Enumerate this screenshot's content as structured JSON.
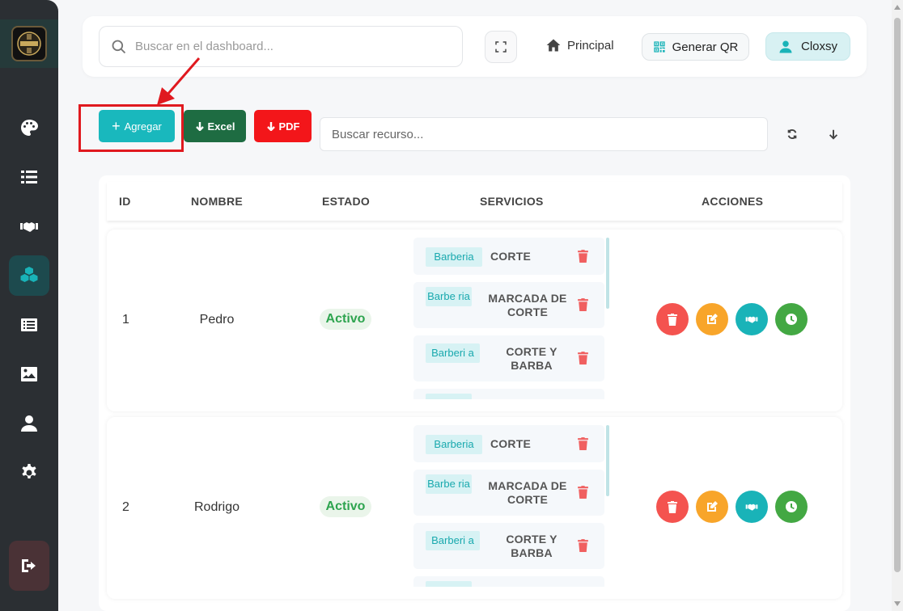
{
  "header": {
    "search_placeholder": "Buscar en el dashboard...",
    "home_label": "Principal",
    "qr_label": "Generar QR",
    "user_label": "Cloxsy"
  },
  "sidebar": {
    "items": [
      {
        "icon": "palette-icon"
      },
      {
        "icon": "list-icon"
      },
      {
        "icon": "handshake-icon"
      },
      {
        "icon": "cubes-icon",
        "active": true
      },
      {
        "icon": "list-alt-icon"
      },
      {
        "icon": "image-icon"
      },
      {
        "icon": "user-icon"
      },
      {
        "icon": "gear-icon"
      },
      {
        "icon": "logout-icon"
      }
    ]
  },
  "toolbar": {
    "add_label": "Agregar",
    "excel_label": "Excel",
    "pdf_label": "PDF",
    "resource_search_placeholder": "Buscar recurso..."
  },
  "table": {
    "headers": {
      "id": "ID",
      "name": "NOMBRE",
      "status": "ESTADO",
      "services": "SERVICIOS",
      "actions": "ACCIONES"
    },
    "rows": [
      {
        "id": "1",
        "name": "Pedro",
        "status": "Activo",
        "services": [
          {
            "tag": "Barberia",
            "name": "CORTE"
          },
          {
            "tag": "Barbe ria",
            "name": "MARCADA DE CORTE"
          },
          {
            "tag": "Barberi a",
            "name": "CORTE Y BARBA"
          }
        ]
      },
      {
        "id": "2",
        "name": "Rodrigo",
        "status": "Activo",
        "services": [
          {
            "tag": "Barberia",
            "name": "CORTE"
          },
          {
            "tag": "Barbe ria",
            "name": "MARCADA DE CORTE"
          },
          {
            "tag": "Barberi a",
            "name": "CORTE Y BARBA"
          }
        ]
      }
    ]
  },
  "colors": {
    "accent": "#19b8bd",
    "excel": "#1e6c42",
    "pdf": "#f3161a",
    "highlight": "#e0191f",
    "status_active": "#2ea44f"
  }
}
